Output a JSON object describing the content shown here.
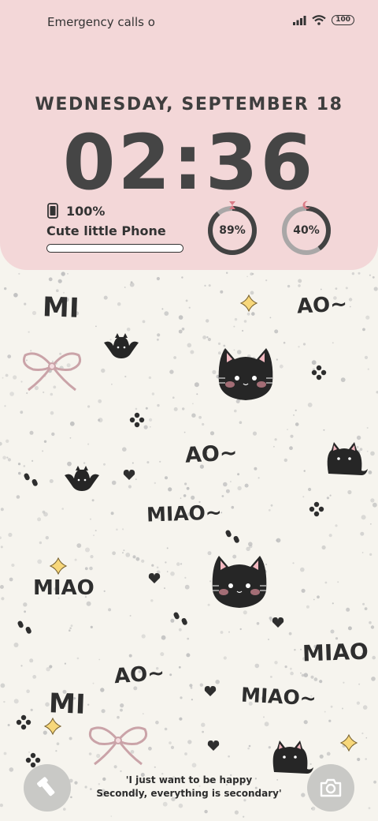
{
  "status_bar": {
    "carrier": "Emergency calls o",
    "battery": "100"
  },
  "lock_widget": {
    "date": "WEDNESDAY, SEPTEMBER  18",
    "time": "02:36",
    "battery_percent": "100%",
    "device_name": "Cute little Phone",
    "progress": 1.0,
    "gauges": [
      {
        "label": "89%",
        "value": 0.89,
        "icon": "hourglass-icon"
      },
      {
        "label": "40%",
        "value": 0.4,
        "icon": "moon-icon"
      }
    ]
  },
  "wallpaper": {
    "words": [
      "MI",
      "AO~",
      "AO~",
      "MIAO~",
      "MIAO",
      "MIAO",
      "AO~",
      "MIAO~",
      "MI"
    ],
    "colors": {
      "ink": "#2e2e2e",
      "pink": "#f3d7d8",
      "yellow": "#f7d77a"
    }
  },
  "quote": {
    "line1": "'I just want to be happy",
    "line2": "Secondly, everything is secondary'"
  },
  "shortcuts": {
    "left_icon": "flashlight-icon",
    "right_icon": "camera-icon"
  }
}
